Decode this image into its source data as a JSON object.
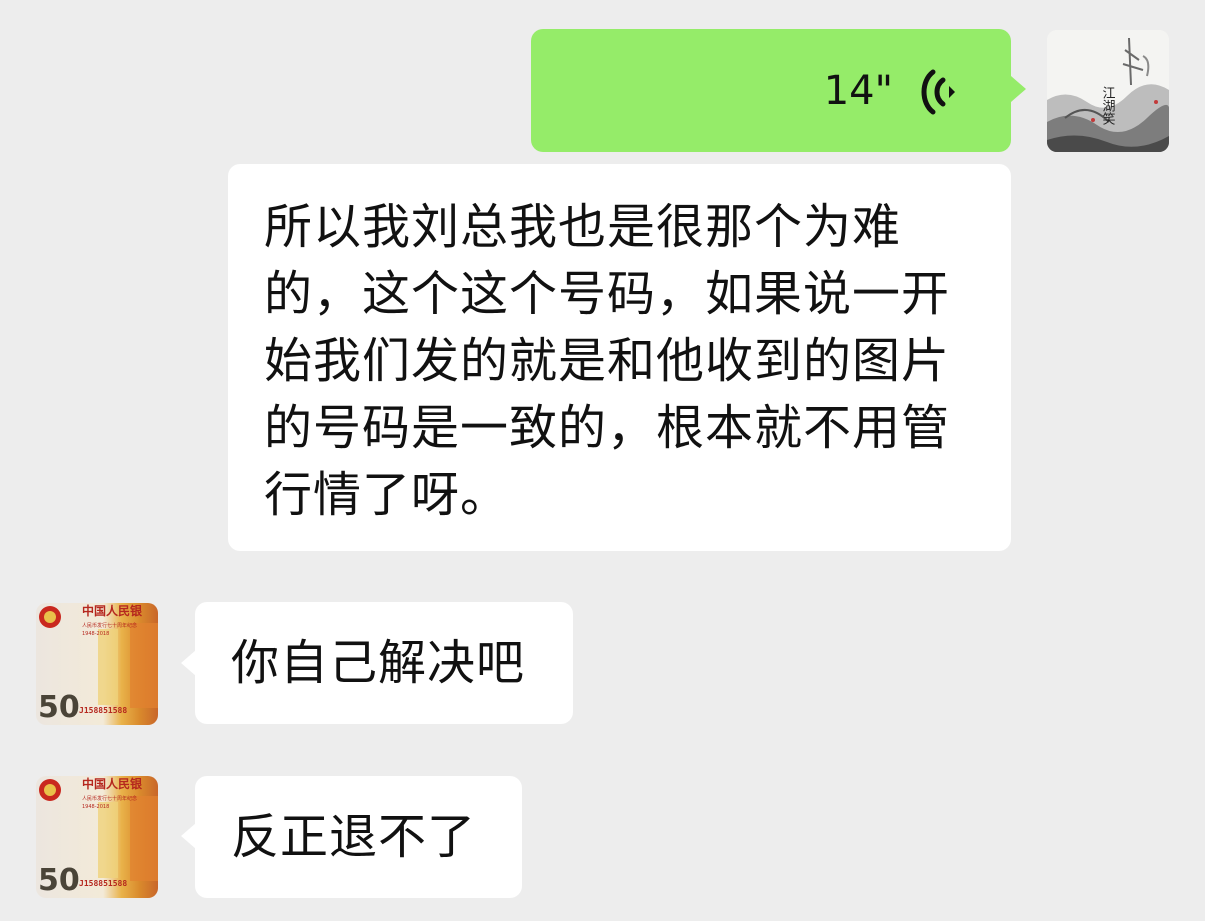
{
  "messages": [
    {
      "side": "right",
      "type": "voice",
      "duration": "14\"",
      "avatar": "ink-painting-avatar",
      "avatar_text": "江湖笑"
    },
    {
      "side": "right",
      "type": "text",
      "text": "所以我刘总我也是很那个为难的，这个这个号码，如果说一开始我们发的就是和他收到的图片的号码是一致的，根本就不用管行情了呀。"
    },
    {
      "side": "left",
      "type": "text",
      "text": "你自己解决吧",
      "avatar": "banknote-avatar"
    },
    {
      "side": "left",
      "type": "text",
      "text": "反正退不了",
      "avatar": "banknote-avatar"
    }
  ],
  "banknote_avatar": {
    "header": "中国人民银",
    "subtitle": "人民币发行七十周年纪念",
    "years": "1948-2018",
    "denomination": "50",
    "serial": "J158851588"
  },
  "colors": {
    "background": "#ededed",
    "sent_bubble": "#95ec69",
    "received_bubble": "#ffffff"
  },
  "icons": {
    "voice": "voice-wave-icon"
  }
}
